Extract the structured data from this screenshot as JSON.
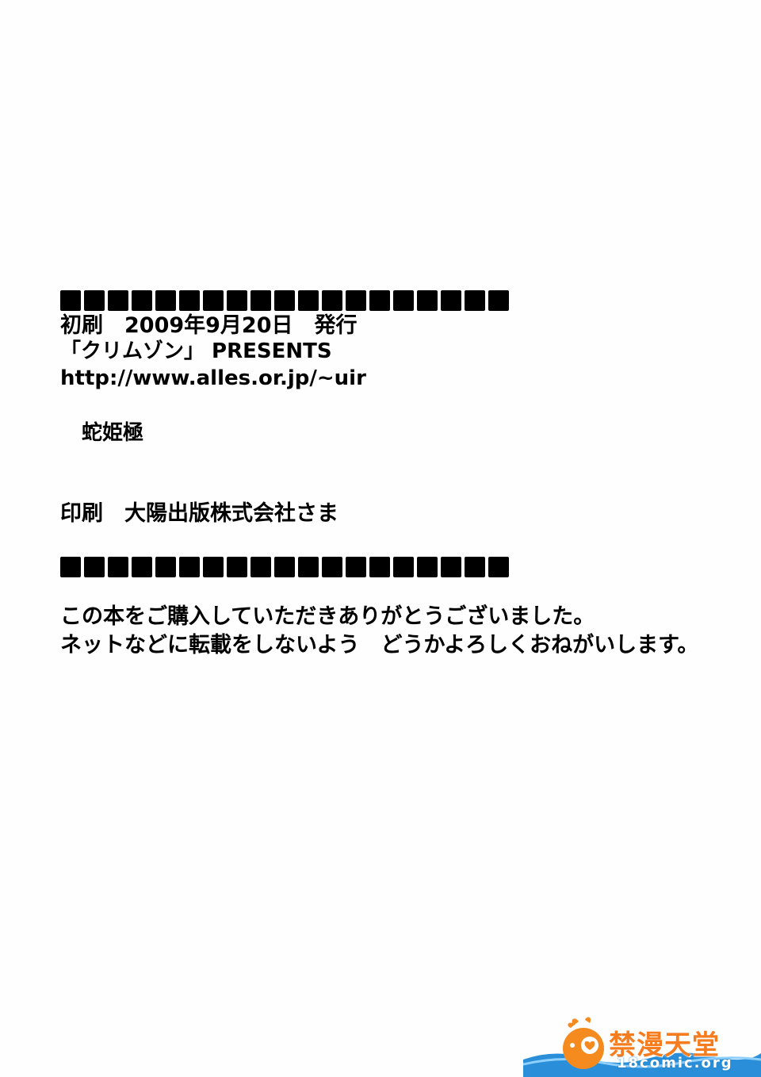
{
  "colophon": {
    "date_line": "初刷　2009年9月20日　発行",
    "circle_line": "「クリムゾン」 PRESENTS",
    "url_line": "http://www.alles.or.jp/~uir",
    "title_line": "蛇姫極",
    "printer_line": "印刷　大陽出版株式会社さま"
  },
  "message": {
    "thanks_line": "この本をご購入していただきありがとうございました。",
    "request_line": "ネットなどに転載をしないよう　どうかよろしくおねがいします。"
  },
  "watermark": {
    "name": "禁漫天堂",
    "domain": "18comic.org",
    "colors": {
      "name": "#f57c1f",
      "wave": "#2a8fd8",
      "mascot": "#f58a1f"
    }
  }
}
